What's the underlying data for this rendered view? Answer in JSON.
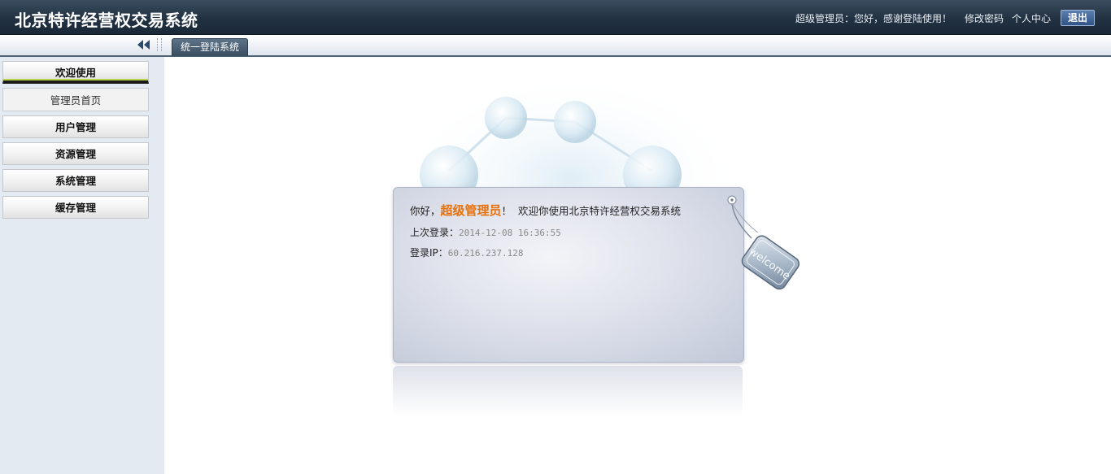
{
  "header": {
    "title": "北京特许经营权交易系统",
    "greeting": "超级管理员：您好，感谢登陆使用！",
    "change_password": "修改密码",
    "personal_center": "个人中心",
    "logout": "退出"
  },
  "tabbar": {
    "tabs": [
      "统一登陆系统"
    ]
  },
  "sidebar": {
    "items": [
      {
        "label": "欢迎使用",
        "sub": [
          "管理员首页"
        ]
      },
      {
        "label": "用户管理"
      },
      {
        "label": "资源管理"
      },
      {
        "label": "系统管理"
      },
      {
        "label": "缓存管理"
      }
    ]
  },
  "welcome": {
    "hello": "你好，",
    "username": "超级管理员",
    "exclaim": "！",
    "message": "欢迎你使用北京特许经营权交易系统",
    "last_login_label": "上次登录：",
    "last_login_value": "2014-12-08 16:36:55",
    "ip_label": "登录IP：",
    "ip_value": "60.216.237.128",
    "tag_text": "welcome"
  },
  "colors": {
    "header_bg": "#223243",
    "accent_username": "#e8710a",
    "sidebar_bg": "#e4eaf1",
    "active_indicator": "#b9d44a"
  }
}
